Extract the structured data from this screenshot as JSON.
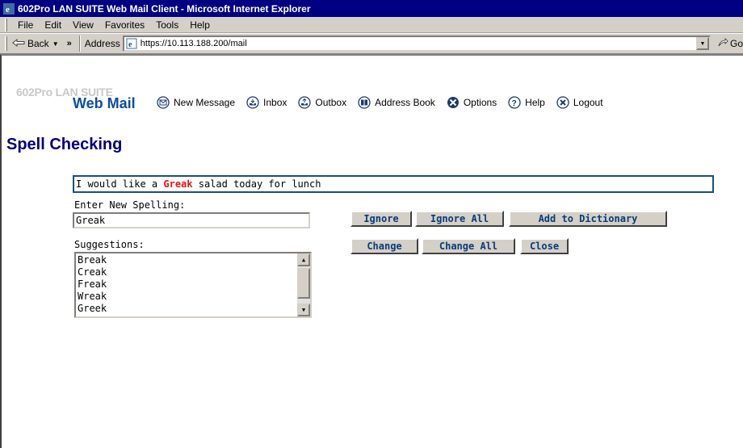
{
  "window": {
    "title": "602Pro LAN SUITE Web Mail Client - Microsoft Internet Explorer"
  },
  "menubar": {
    "items": [
      {
        "label": "File"
      },
      {
        "label": "Edit"
      },
      {
        "label": "View"
      },
      {
        "label": "Favorites"
      },
      {
        "label": "Tools"
      },
      {
        "label": "Help"
      }
    ]
  },
  "toolbar": {
    "back_label": "Back",
    "chevron": "»",
    "address_label": "Address",
    "address_value": "https://10.113.188.200/mail",
    "go_label": "Go"
  },
  "logo": {
    "top": "602Pro LAN SUITE",
    "main": "Web Mail"
  },
  "nav": {
    "items": [
      {
        "label": "New Message",
        "icon": "envelope-icon"
      },
      {
        "label": "Inbox",
        "icon": "inbox-icon"
      },
      {
        "label": "Outbox",
        "icon": "outbox-icon"
      },
      {
        "label": "Address Book",
        "icon": "address-book-icon"
      },
      {
        "label": "Options",
        "icon": "options-icon"
      },
      {
        "label": "Help",
        "icon": "help-icon"
      },
      {
        "label": "Logout",
        "icon": "logout-icon"
      }
    ]
  },
  "spell": {
    "title": "Spell Checking",
    "sentence_before": "I would like a ",
    "misspelled_word": "Greak",
    "sentence_after": " salad today for lunch",
    "new_spelling_label": "Enter New Spelling:",
    "new_spelling_value": "Greak",
    "suggestions_label": "Suggestions:",
    "suggestions": [
      "Break",
      "Creak",
      "Freak",
      "Wreak",
      "Greek"
    ],
    "buttons": {
      "ignore": "Ignore",
      "ignore_all": "Ignore All",
      "add_to_dictionary": "Add to Dictionary",
      "change": "Change",
      "change_all": "Change All",
      "close": "Close"
    }
  },
  "colors": {
    "titlebar": "#000080",
    "page_title": "#00007f",
    "misspelled": "#ee1111",
    "button_text": "#0a3a7a",
    "logo_main": "#0a4ea0"
  }
}
